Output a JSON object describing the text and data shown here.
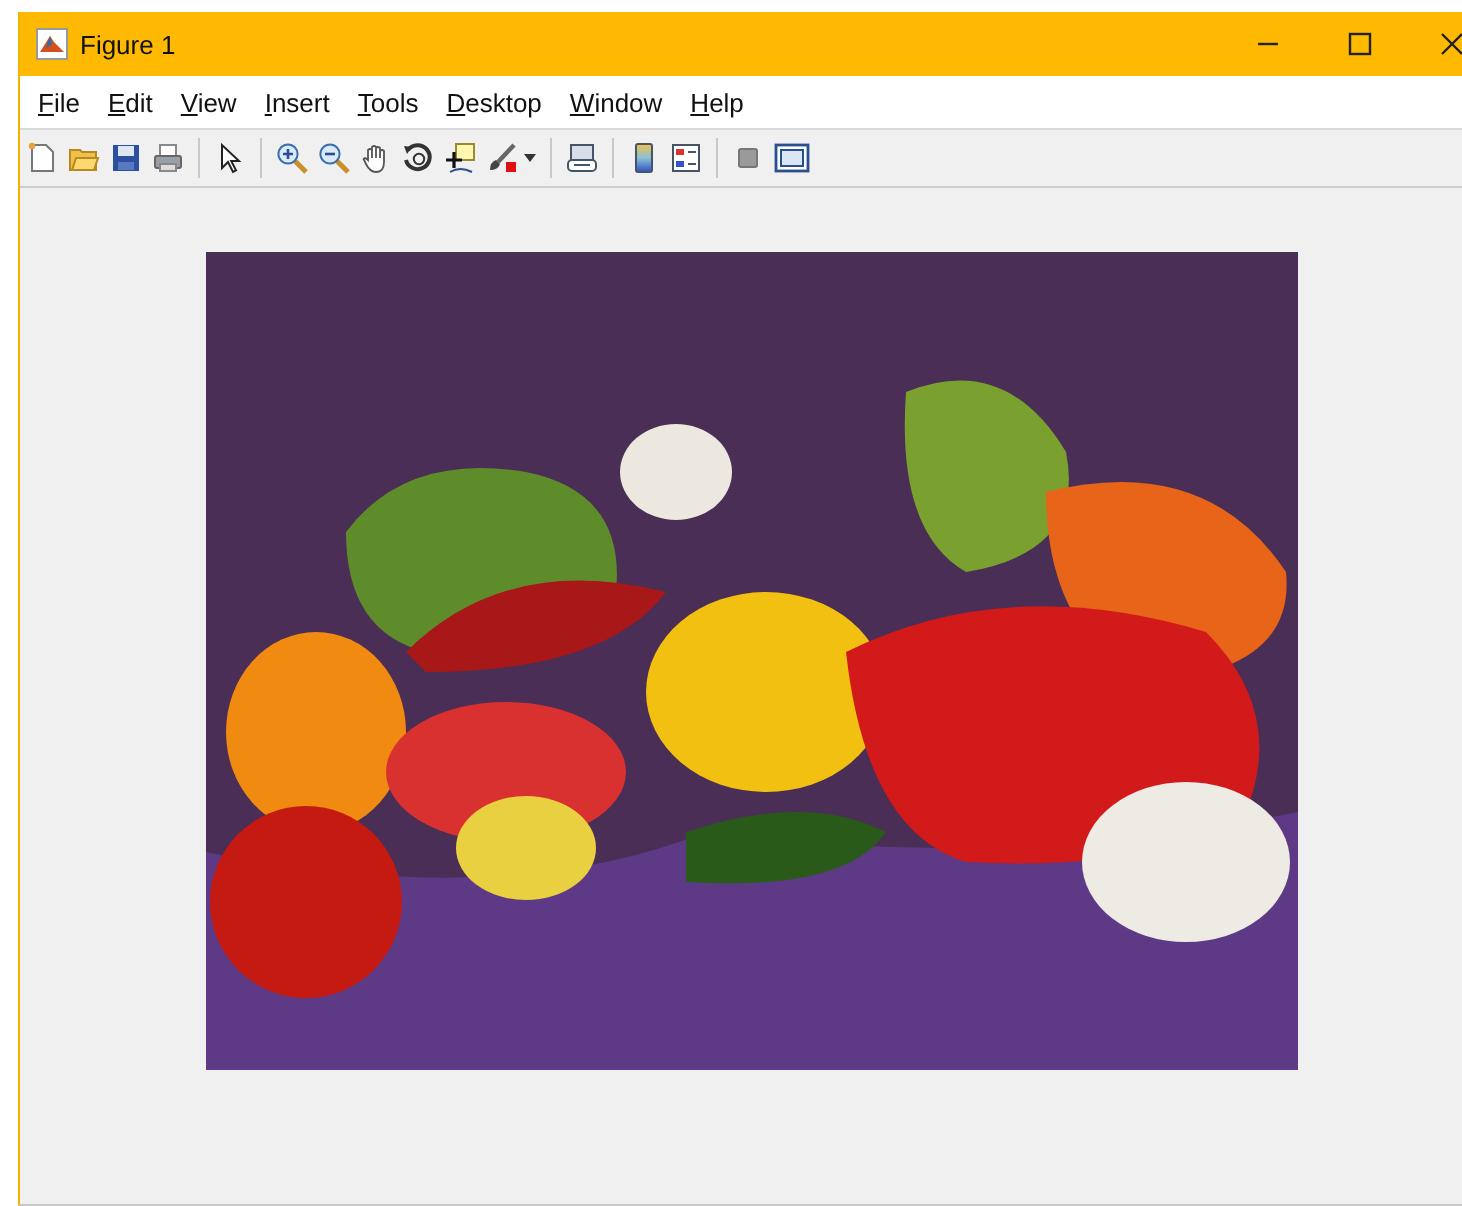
{
  "window": {
    "title": "Figure 1"
  },
  "menu": [
    {
      "label": "File"
    },
    {
      "label": "Edit"
    },
    {
      "label": "View"
    },
    {
      "label": "Insert"
    },
    {
      "label": "Tools"
    },
    {
      "label": "Desktop"
    },
    {
      "label": "Window"
    },
    {
      "label": "Help"
    }
  ]
}
